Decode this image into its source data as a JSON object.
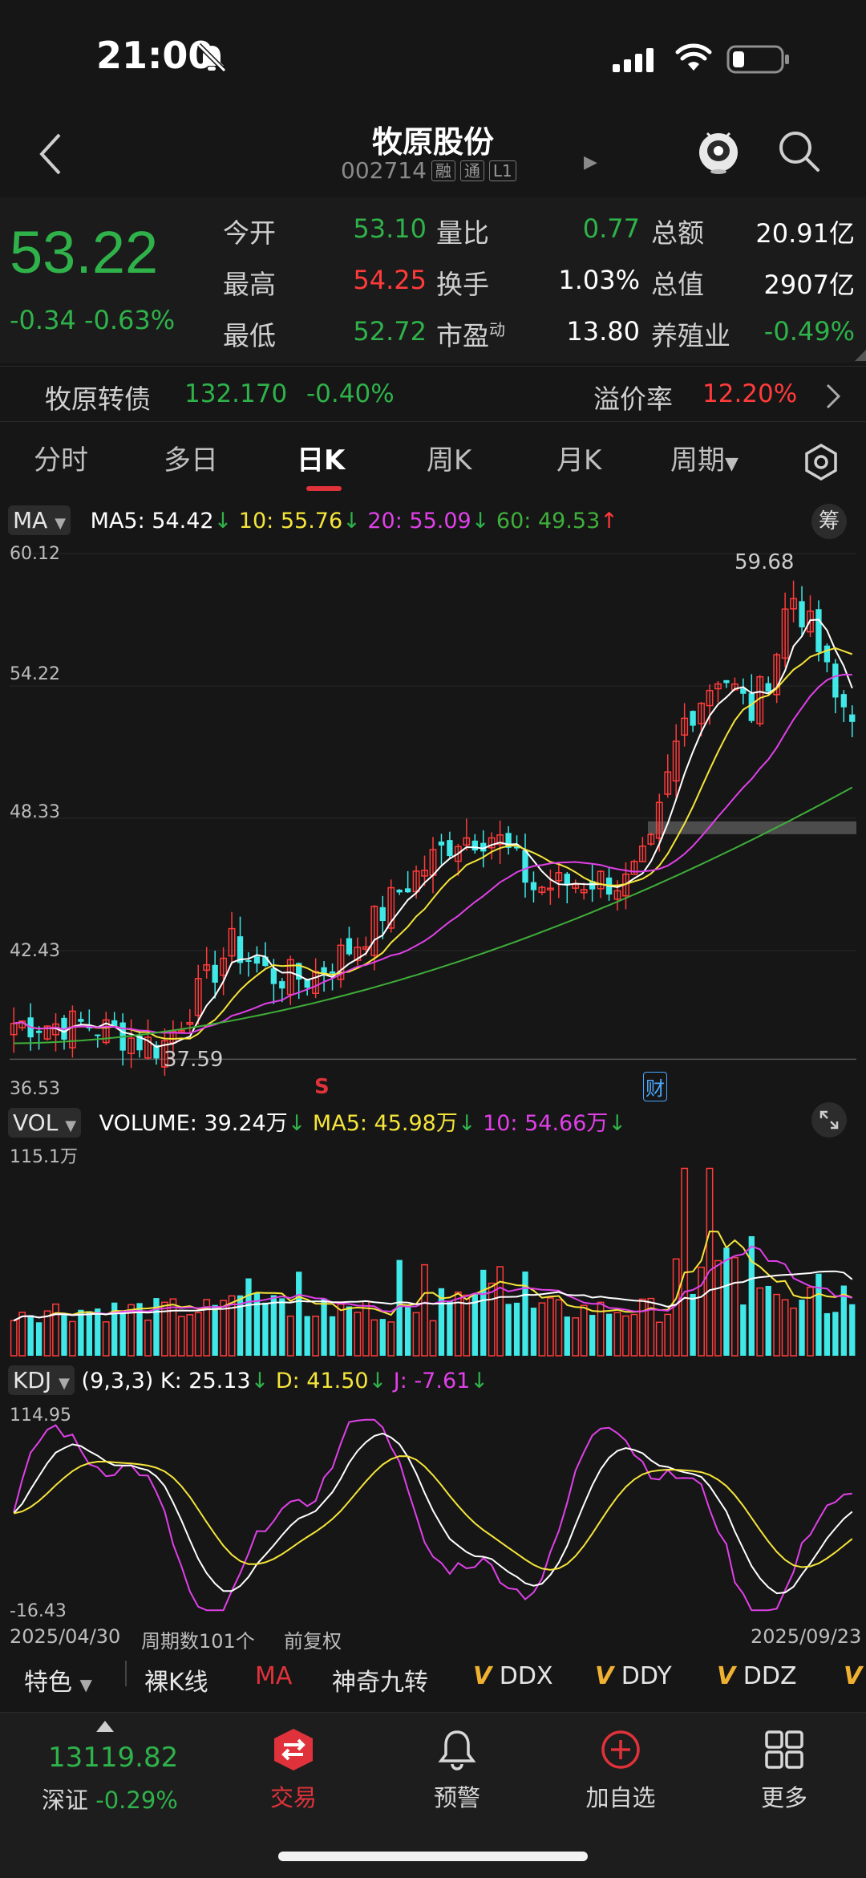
{
  "status_bar": {
    "time": "21:00"
  },
  "header": {
    "stock_name": "牧原股份",
    "stock_code": "002714",
    "tags": [
      "融",
      "通",
      "L1"
    ]
  },
  "quote": {
    "price": "53.22",
    "change": "-0.34",
    "change_pct": "-0.63%",
    "open_label": "今开",
    "open": "53.10",
    "high_label": "最高",
    "high": "54.25",
    "low_label": "最低",
    "low": "52.72",
    "volume_ratio_label": "量比",
    "volume_ratio": "0.77",
    "turnover_label": "换手",
    "turnover": "1.03%",
    "pe_label": "市盈",
    "pe_sup": "动",
    "pe": "13.80",
    "amount_label": "总额",
    "amount": "20.91亿",
    "market_cap_label": "总值",
    "market_cap": "2907亿",
    "sector_label": "养殖业",
    "sector_change": "-0.49%"
  },
  "bond": {
    "name": "牧原转债",
    "price": "132.170",
    "change": "-0.40%",
    "premium_label": "溢价率",
    "premium": "12.20%"
  },
  "tabs": [
    {
      "label": "分时"
    },
    {
      "label": "多日"
    },
    {
      "label": "日K",
      "active": true
    },
    {
      "label": "周K"
    },
    {
      "label": "月K"
    },
    {
      "label": "周期"
    }
  ],
  "ma_legend": {
    "selector": "MA",
    "ma5": "MA5: 54.42",
    "ma10": "10: 55.76",
    "ma20": "20: 55.09",
    "ma60": "60: 49.53",
    "chip_btn": "筹"
  },
  "kline_axis": [
    "60.12",
    "54.22",
    "48.33",
    "42.43",
    "36.53"
  ],
  "kline_annotations": {
    "high": "59.68",
    "low": "37.59",
    "sell_mark": "S",
    "report_mark": "财"
  },
  "vol_legend": {
    "selector": "VOL",
    "volume": "VOLUME: 39.24万",
    "ma5": "MA5: 45.98万",
    "ma10": "10: 54.66万"
  },
  "vol_axis_max": "115.1万",
  "kdj_legend": {
    "selector": "KDJ",
    "params": "(9,3,3)",
    "k": "K: 25.13",
    "d": "D: 41.50",
    "j": "J: -7.61"
  },
  "kdj_axis": [
    "114.95",
    "-16.43"
  ],
  "footer_info": {
    "start_date": "2025/04/30",
    "period_count": "周期数101个",
    "adjust": "前复权",
    "end_date": "2025/09/23"
  },
  "toolbar": {
    "feature": "特色",
    "items": [
      "裸K线",
      "MA",
      "神奇九转",
      "DDX",
      "DDY",
      "DDZ"
    ]
  },
  "bottom_nav": {
    "index_value": "13119.82",
    "index_name": "深证",
    "index_change": "-0.29%",
    "trade": "交易",
    "alert": "预警",
    "add_watch": "加自选",
    "more": "更多"
  },
  "colors": {
    "up": "#ff3b3b",
    "down": "#40e8e8",
    "price_down": "#2fb24a",
    "ma5": "#ffffff",
    "ma10": "#f5e53a",
    "ma20": "#e040e8",
    "ma60": "#3fae3a"
  }
}
